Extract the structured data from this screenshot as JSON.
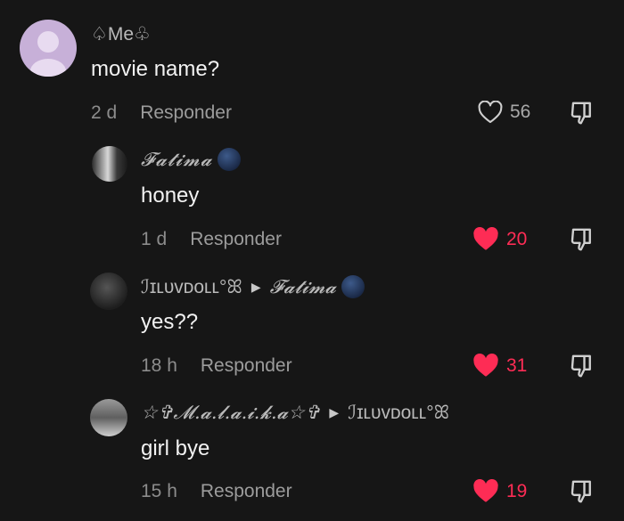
{
  "colors": {
    "background": "#161616",
    "like_active": "#fe2c55",
    "avatar_main": "#c7b0d8"
  },
  "comments": [
    {
      "username": "♤Me♧",
      "text": "movie name?",
      "time": "2 d",
      "reply_label": "Responder",
      "likes": "56",
      "liked": false
    },
    {
      "username": "𝓕𝓪𝓽𝓲𝓶𝓪",
      "text": "honey",
      "time": "1 d",
      "reply_label": "Responder",
      "likes": "20",
      "liked": true
    },
    {
      "username": "ℐɪʟᴜᴠᴅᴏʟʟ°ꕤ",
      "reply_to": "𝓕𝓪𝓽𝓲𝓶𝓪",
      "text": "yes??",
      "time": "18 h",
      "reply_label": "Responder",
      "likes": "31",
      "liked": true
    },
    {
      "username": "☆✞𝓜.𝓪.𝓵.𝓪.𝓲.𝓴.𝓪☆✞",
      "reply_to": "ℐɪʟᴜᴠᴅᴏʟʟ°ꕤ",
      "text": "girl bye",
      "time": "15 h",
      "reply_label": "Responder",
      "likes": "19",
      "liked": true
    }
  ]
}
